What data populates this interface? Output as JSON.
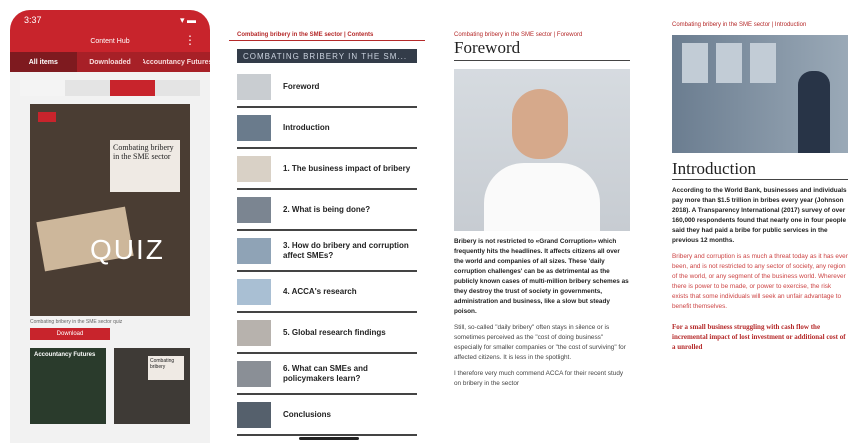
{
  "screen1": {
    "status_time": "3:37",
    "status_icons": "▾ ▬",
    "appbar_title": "Content Hub",
    "tabs": [
      "All items",
      "Downloaded",
      "Accountancy Futures"
    ],
    "cover_title": "Combating bribery in the SME sector",
    "cover_word": "QUIZ",
    "caption": "Combating bribery in the SME sector quiz",
    "download_label": "Download",
    "thumb1_label": "Accountancy Futures",
    "thumb2_title": "Combating bribery"
  },
  "screen2": {
    "top_title": "Combating bribery in the SME sector | Contents",
    "section_title": "COMBATING BRIBERY IN THE SM...",
    "toc": [
      "Foreword",
      "Introduction",
      "1. The business impact of bribery",
      "2. What is being done?",
      "3. How do bribery and corruption affect SMEs?",
      "4. ACCA's research",
      "5. Global research findings",
      "6. What can SMEs and policymakers learn?",
      "Conclusions"
    ]
  },
  "screen3": {
    "crumb": "Combating bribery in the SME sector | Foreword",
    "heading": "Foreword",
    "bold_para": "Bribery is not restricted to «Grand Corruption» which frequently hits the headlines. It affects citizens all over the world and companies of all sizes. These 'daily corruption challenges' can be as detrimental as the publicly known cases of multi-million bribery schemes as they destroy the trust of society in governments, administration and business, like a slow but steady poison.",
    "para2": "Still, so-called \"daily bribery\" often stays in silence or is sometimes perceived as the \"cost of doing business\" especially for smaller companies or \"the cost of surviving\" for affected citizens. It is less in the spotlight.",
    "para3": "I therefore very much commend ACCA for their recent study on bribery in the sector"
  },
  "screen4": {
    "crumb": "Combating bribery in the SME sector | Introduction",
    "heading": "Introduction",
    "bold_para": "According to the World Bank, businesses and individuals pay more than $1.5 trillion in bribes every year (Johnson 2018). A Transparency International (2017) survey of over 160,000 respondents found that nearly one in four people said they had paid a bribe for public services in the previous 12 months.",
    "para2": "Bribery and corruption is as much a threat today as it has ever been, and is not restricted to any sector of society, any region of the world, or any segment of the business world. Wherever there is power to be made, or power to exercise, the risk exists that some individuals will seek an unfair advantage to benefit themselves.",
    "pull": "For a small business struggling with cash flow the incremental impact of lost investment or additional cost of a unrolled"
  }
}
